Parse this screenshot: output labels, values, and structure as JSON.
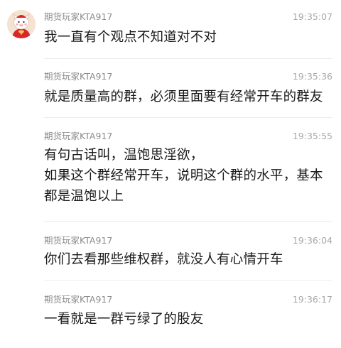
{
  "messages": [
    {
      "sender": "期货玩家KTA917",
      "time": "19:35:07",
      "lines": [
        "我一直有个观点不知道对不对"
      ]
    },
    {
      "sender": "期货玩家KTA917",
      "time": "19:35:36",
      "lines": [
        "就是质量高的群，必须里面要有经常开车的群友"
      ]
    },
    {
      "sender": "期货玩家KTA917",
      "time": "19:35:55",
      "lines": [
        "有句古话叫，温饱思淫欲，",
        "如果这个群经常开车，说明这个群的水平，基本",
        "都是温饱以上"
      ]
    },
    {
      "sender": "期货玩家KTA917",
      "time": "19:36:04",
      "lines": [
        "你们去看那些维权群，就没人有心情开车"
      ]
    },
    {
      "sender": "期货玩家KTA917",
      "time": "19:36:17",
      "lines": [
        "一看就是一群亏绿了的股友"
      ]
    }
  ],
  "avatar": {
    "icon": "pig-mascot-avatar-icon",
    "bg": "#f2dcc6",
    "accent": "#d9262c"
  }
}
